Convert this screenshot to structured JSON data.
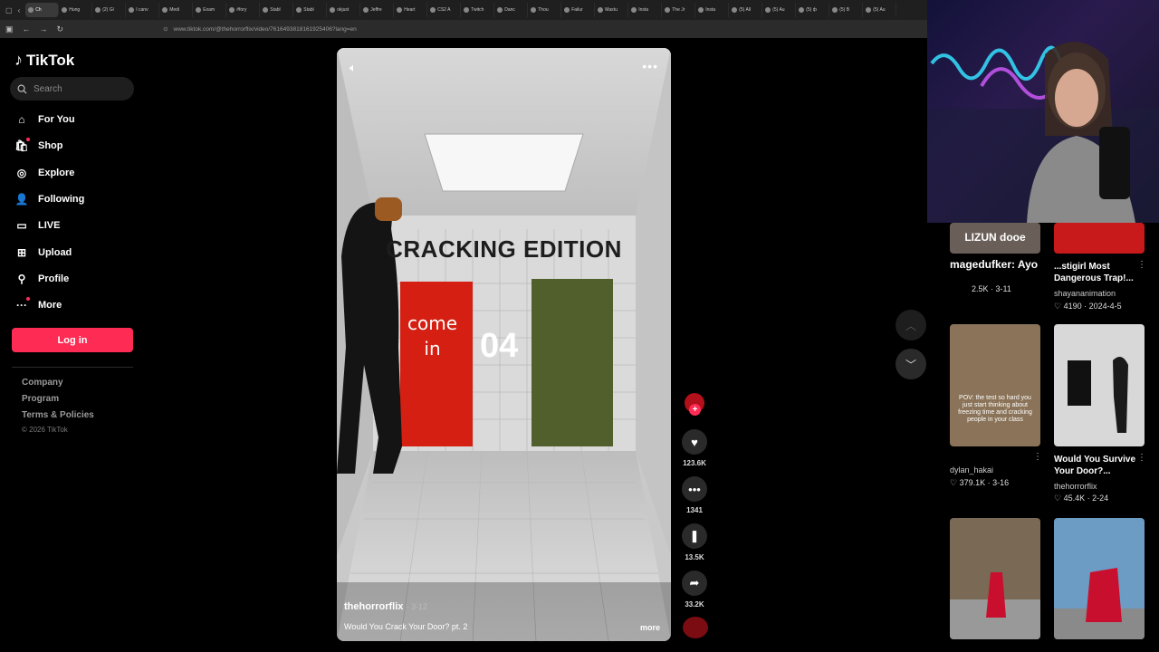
{
  "browser": {
    "tabs": [
      {
        "label": "Ch",
        "active": true
      },
      {
        "label": "Hung"
      },
      {
        "label": "(2) Gl"
      },
      {
        "label": "I canv"
      },
      {
        "label": "Medi"
      },
      {
        "label": "Exam"
      },
      {
        "label": "#fory"
      },
      {
        "label": "Stabl"
      },
      {
        "label": "Stabl"
      },
      {
        "label": "okjust"
      },
      {
        "label": "Jeffre"
      },
      {
        "label": "Heart"
      },
      {
        "label": "CS2 A"
      },
      {
        "label": "Twitch"
      },
      {
        "label": "Danc"
      },
      {
        "label": "Thou"
      },
      {
        "label": "Failur"
      },
      {
        "label": "Mastu"
      },
      {
        "label": "Insta"
      },
      {
        "label": "The Jr"
      },
      {
        "label": "Insta"
      },
      {
        "label": "(5) All"
      },
      {
        "label": "(5) Au"
      },
      {
        "label": "(5) ф"
      },
      {
        "label": "(5) B"
      },
      {
        "label": "(5) Au"
      }
    ],
    "url": "www.tiktok.com/@thehorrorflix/video/7616493818161925406?lang=en"
  },
  "sidebar": {
    "logo": "TikTok",
    "search_placeholder": "Search",
    "nav": [
      {
        "label": "For You",
        "icon": "home-icon"
      },
      {
        "label": "Shop",
        "icon": "shop-icon"
      },
      {
        "label": "Explore",
        "icon": "compass-icon"
      },
      {
        "label": "Following",
        "icon": "following-icon"
      },
      {
        "label": "LIVE",
        "icon": "live-icon"
      },
      {
        "label": "Upload",
        "icon": "upload-icon"
      },
      {
        "label": "Profile",
        "icon": "profile-icon"
      },
      {
        "label": "More",
        "icon": "more-icon"
      }
    ],
    "login": "Log in",
    "footer": [
      "Company",
      "Program",
      "Terms & Policies"
    ],
    "copyright": "© 2026 TikTok"
  },
  "video": {
    "overlay_title": "CRACKING EDITION",
    "door_text_line1": "come",
    "door_text_line2": "in",
    "door_number": "04",
    "username": "thehorrorflix",
    "date": "· 3-12",
    "description": "Would You Crack Your Door? pt. 2",
    "more": "more"
  },
  "actions": {
    "likes": "123.6K",
    "comments": "1341",
    "saves": "13.5K",
    "shares": "33.2K",
    "follow": "+"
  },
  "recommended": [
    {
      "overlay": "LIZUN dooe",
      "user": "2.5K",
      "date": "3-11",
      "stat": "2.5K · 3-11",
      "title": "",
      "chat": "magedufker: Ayo"
    },
    {
      "title": "...stigirl Most Dangerous Trap!...",
      "user": "shayananimation",
      "stat": "4190 · 2024-4-5"
    },
    {
      "overlay": "POV: the test so hard you just start thinking about freezing time and cracking people in your class",
      "user": "dylan_hakai",
      "stat": "379.1K · 3-16"
    },
    {
      "title": "Would You Survive Your Door?...",
      "user": "thehorrorflix",
      "stat": "45.4K · 2-24"
    },
    {
      "title": ""
    },
    {
      "title": ""
    }
  ],
  "colors": {
    "brand": "#fe2c55",
    "background": "#000000"
  }
}
